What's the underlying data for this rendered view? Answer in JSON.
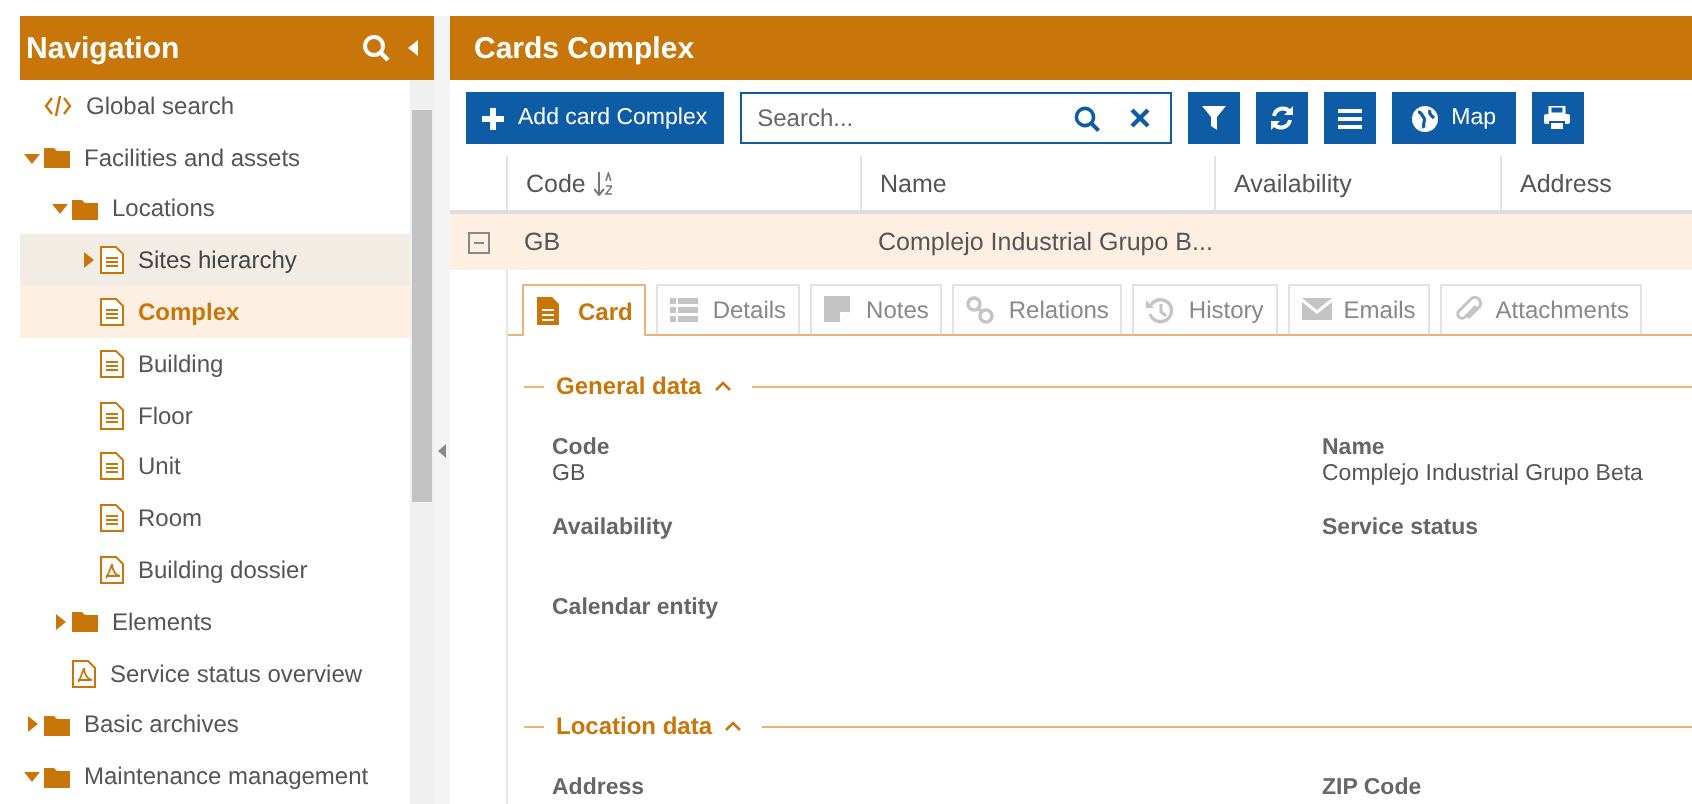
{
  "navigation": {
    "title": "Navigation",
    "items": [
      {
        "label": "Global search",
        "kind": "code",
        "selected": false,
        "hovered": false
      },
      {
        "label": "Facilities and assets",
        "kind": "folder",
        "expanded": true,
        "selected": false,
        "hovered": false,
        "children": [
          {
            "label": "Locations",
            "kind": "folder",
            "expanded": true,
            "selected": false,
            "hovered": false,
            "children": [
              {
                "label": "Sites hierarchy",
                "kind": "page",
                "expanded": false,
                "selected": false,
                "hovered": true
              },
              {
                "label": "Complex",
                "kind": "page",
                "selected": true,
                "hovered": false
              },
              {
                "label": "Building",
                "kind": "page",
                "selected": false,
                "hovered": false
              },
              {
                "label": "Floor",
                "kind": "page",
                "selected": false,
                "hovered": false
              },
              {
                "label": "Unit",
                "kind": "page",
                "selected": false,
                "hovered": false
              },
              {
                "label": "Room",
                "kind": "page",
                "selected": false,
                "hovered": false
              },
              {
                "label": "Building dossier",
                "kind": "pdf",
                "selected": false,
                "hovered": false
              }
            ]
          },
          {
            "label": "Elements",
            "kind": "folder",
            "expanded": false,
            "selected": false,
            "hovered": false
          },
          {
            "label": "Service status overview",
            "kind": "pdf",
            "selected": false,
            "hovered": false
          }
        ]
      },
      {
        "label": "Basic archives",
        "kind": "folder",
        "expanded": false,
        "selected": false,
        "hovered": false
      },
      {
        "label": "Maintenance management",
        "kind": "folder",
        "expanded": true,
        "selected": false,
        "hovered": false
      }
    ]
  },
  "main": {
    "title": "Cards Complex",
    "toolbar": {
      "add_button": "Add card Complex",
      "search": {
        "placeholder": "Search..."
      },
      "map_button": "Map"
    },
    "table": {
      "columns": [
        {
          "label": "Code",
          "sorted": true
        },
        {
          "label": "Name",
          "sorted": false
        },
        {
          "label": "Availability",
          "sorted": false
        },
        {
          "label": "Address",
          "sorted": false
        }
      ],
      "rows": [
        {
          "expanded": true,
          "selected": true,
          "code": "GB",
          "name": "Complejo Industrial Grupo B..."
        }
      ]
    },
    "tabs": [
      {
        "label": "Card",
        "selected": true
      },
      {
        "label": "Details",
        "selected": false
      },
      {
        "label": "Notes",
        "selected": false
      },
      {
        "label": "Relations",
        "selected": false
      },
      {
        "label": "History",
        "selected": false
      },
      {
        "label": "Emails",
        "selected": false
      },
      {
        "label": "Attachments",
        "selected": false
      }
    ],
    "sections": [
      {
        "title": "General data",
        "expanded": true,
        "fields": [
          {
            "label": "Code",
            "value": "GB"
          },
          {
            "label": "Name",
            "value": "Complejo Industrial Grupo Beta"
          },
          {
            "label": "Availability"
          },
          {
            "label": "Service status"
          },
          {
            "label": "Calendar entity"
          }
        ]
      },
      {
        "title": "Location data",
        "expanded": true,
        "fields": [
          {
            "label": "Address"
          },
          {
            "label": "ZIP Code"
          }
        ]
      }
    ]
  }
}
